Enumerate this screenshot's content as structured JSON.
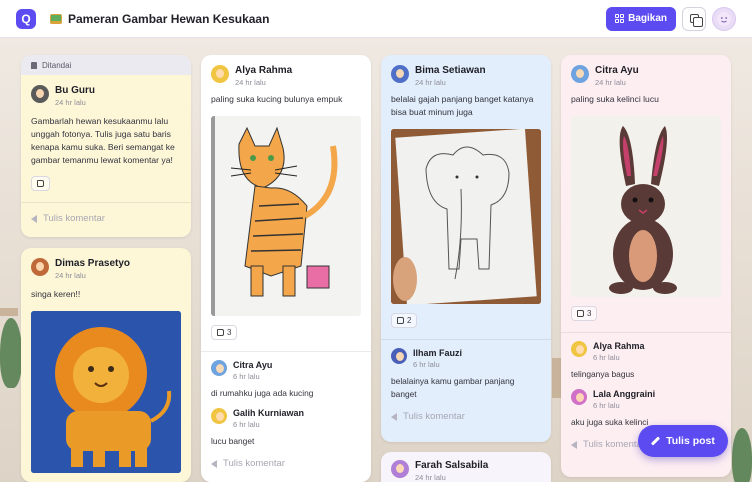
{
  "header": {
    "logo_letter": "Q",
    "title": "Pameran Gambar Hewan Kesukaan",
    "share_label": "Bagikan"
  },
  "columns": [
    {
      "posts": [
        {
          "pinned_label": "Ditandai",
          "author": "Bu Guru",
          "time": "24 hr lalu",
          "text": "Gambarlah hewan kesukaanmu lalu unggah fotonya. Tulis juga satu baris kenapa kamu suka. Beri semangat ke gambar temanmu lewat komentar ya!",
          "comment_placeholder": "Tulis komentar"
        },
        {
          "author": "Dimas Prasetyo",
          "time": "24 hr lalu",
          "text": "singa keren!!"
        }
      ]
    },
    {
      "posts": [
        {
          "author": "Alya Rahma",
          "time": "24 hr lalu",
          "text": "paling suka kucing bulunya empuk",
          "likes": "3",
          "comments": [
            {
              "author": "Citra Ayu",
              "time": "6 hr lalu",
              "text": "di rumahku juga ada kucing"
            },
            {
              "author": "Galih Kurniawan",
              "time": "6 hr lalu",
              "text": "lucu banget"
            }
          ],
          "comment_placeholder": "Tulis komentar"
        }
      ]
    },
    {
      "posts": [
        {
          "author": "Bima Setiawan",
          "time": "24 hr lalu",
          "text": "belalai gajah panjang banget katanya bisa buat minum juga",
          "likes": "2",
          "comments": [
            {
              "author": "Ilham Fauzi",
              "time": "6 hr lalu",
              "text": "belalainya kamu gambar panjang banget"
            }
          ],
          "comment_placeholder": "Tulis komentar"
        },
        {
          "author": "Farah Salsabila",
          "time": "24 hr lalu"
        }
      ]
    },
    {
      "posts": [
        {
          "author": "Citra Ayu",
          "time": "24 hr lalu",
          "text": "paling suka kelinci lucu",
          "likes": "3",
          "comments": [
            {
              "author": "Alya Rahma",
              "time": "6 hr lalu",
              "text": "telinganya bagus"
            },
            {
              "author": "Lala Anggraini",
              "time": "6 hr lalu",
              "text": "aku juga suka kelinci"
            }
          ],
          "comment_placeholder": "Tulis komentar"
        }
      ]
    }
  ],
  "fab_label": "Tulis post",
  "colors": {
    "accent": "#5b4bf0",
    "pinned_card": "#fdf7d8",
    "blue_card": "#e2eefc",
    "pink_card": "#fdeef2"
  }
}
